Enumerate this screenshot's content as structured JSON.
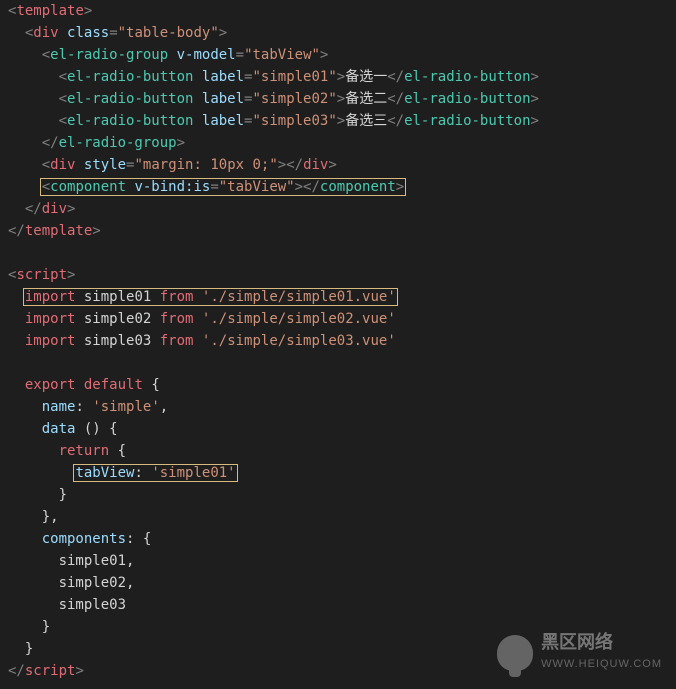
{
  "code": {
    "t_template": "template",
    "t_div": "div",
    "t_elradiogroup": "el-radio-group",
    "t_elradiobutton": "el-radio-button",
    "t_component": "component",
    "t_script": "script",
    "a_class": "class",
    "a_vmodel": "v-model",
    "a_label": "label",
    "a_style": "style",
    "a_vbindis": "v-bind:is",
    "v_tablebody": "\"table-body\"",
    "v_tabView": "\"tabView\"",
    "v_simple01": "\"simple01\"",
    "v_simple02": "\"simple02\"",
    "v_simple03": "\"simple03\"",
    "v_marginstyle": "\"margin: 10px 0;\"",
    "txt_opt1": "备选一",
    "txt_opt2": "备选二",
    "txt_opt3": "备选三",
    "kw_import": "import",
    "kw_from": "from",
    "kw_export": "export",
    "kw_default": "default",
    "kw_return": "return",
    "id_simple01": "simple01",
    "id_simple02": "simple02",
    "id_simple03": "simple03",
    "s_path01": "'./simple/simple01.vue'",
    "s_path02": "'./simple/simple02.vue'",
    "s_path03": "'./simple/simple03.vue'",
    "prop_name": "name",
    "s_name": "'simple'",
    "prop_data": "data",
    "prop_tabView": "tabView",
    "s_tabViewVal": "'simple01'",
    "prop_components": "components",
    "brace_open": "{",
    "brace_close": "}",
    "paren_pair": "()",
    "comma": ",",
    "colon": ":"
  },
  "watermark": {
    "line1": "黑区网络",
    "line2": "WWW.HEIQUW.COM"
  }
}
